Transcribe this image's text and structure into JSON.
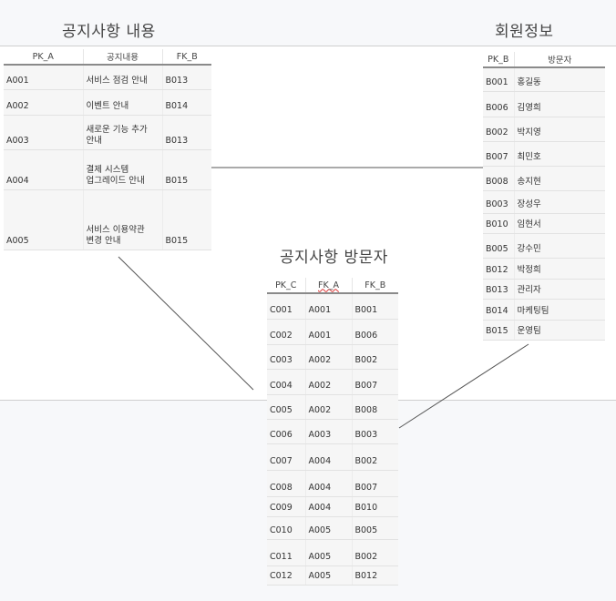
{
  "titles": {
    "notice": "공지사항 내용",
    "member": "회원정보",
    "visitor": "공지사항 방문자"
  },
  "notice_table": {
    "headers": [
      "PK_A",
      "공지내용",
      "FK_B"
    ],
    "rows": [
      [
        "A001",
        "서비스 점검 안내",
        "B013"
      ],
      [
        "A002",
        "이벤트 안내",
        "B014"
      ],
      [
        "A003",
        "새로운 기능 추가\n안내",
        "B013"
      ],
      [
        "A004",
        "결제 시스템\n업그레이드 안내",
        "B015"
      ],
      [
        "A005",
        "서비스 이용약관\n변경 안내",
        "B015"
      ]
    ]
  },
  "member_table": {
    "headers": [
      "PK_B",
      "방문자"
    ],
    "rows": [
      [
        "B001",
        "홍길동"
      ],
      [
        "B006",
        "김영희"
      ],
      [
        "B002",
        "박지영"
      ],
      [
        "B007",
        "최민호"
      ],
      [
        "B008",
        "송지현"
      ],
      [
        "B003",
        "장성우"
      ],
      [
        "B010",
        "임현서"
      ],
      [
        "B005",
        "강수민"
      ],
      [
        "B012",
        "박정희"
      ],
      [
        "B013",
        "관리자"
      ],
      [
        "B014",
        "마케팅팀"
      ],
      [
        "B015",
        "운영팀"
      ]
    ]
  },
  "visitor_table": {
    "headers": [
      "PK_C",
      "FK_A",
      "FK_B"
    ],
    "rows": [
      [
        "C001",
        "A001",
        "B001"
      ],
      [
        "C002",
        "A001",
        "B006"
      ],
      [
        "C003",
        "A002",
        "B002"
      ],
      [
        "C004",
        "A002",
        "B007"
      ],
      [
        "C005",
        "A002",
        "B008"
      ],
      [
        "C006",
        "A003",
        "B003"
      ],
      [
        "C007",
        "A004",
        "B002"
      ],
      [
        "C008",
        "A004",
        "B007"
      ],
      [
        "C009",
        "A004",
        "B010"
      ],
      [
        "C010",
        "A005",
        "B005"
      ],
      [
        "C011",
        "A005",
        "B002"
      ],
      [
        "C012",
        "A005",
        "B012"
      ]
    ]
  }
}
